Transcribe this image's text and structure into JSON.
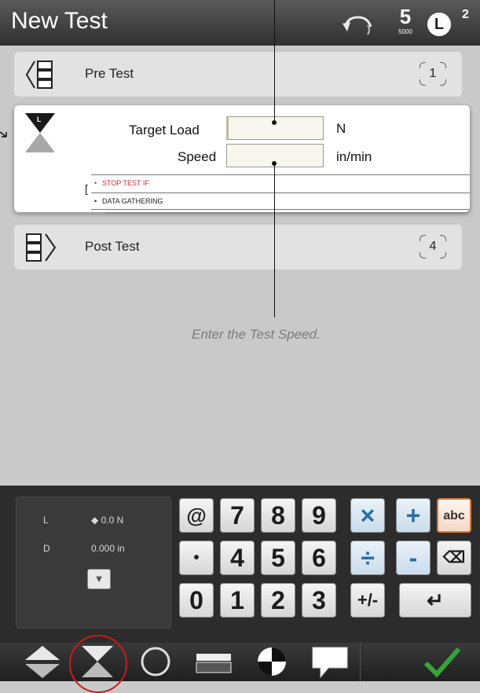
{
  "header": {
    "title": "New Test",
    "five_value": "5",
    "five_sub": "5000",
    "load_badge": "L",
    "load_badge_sup": "2"
  },
  "rows": {
    "pre_test": {
      "label": "Pre Test",
      "count": "1"
    },
    "post_test": {
      "label": "Post Test",
      "count": "4"
    }
  },
  "load_card": {
    "target_label": "Target Load",
    "speed_label": "Speed",
    "target_value": "",
    "speed_value": "",
    "target_unit": "N",
    "speed_unit": "in/min",
    "section_stop": "STOP TEST IF",
    "section_data": "DATA GATHERING",
    "left_char": "["
  },
  "callout": "Enter the Test Speed.",
  "status": {
    "l_label": "L",
    "l_value": "0.0 N",
    "d_label": "D",
    "d_value": "0.000 in"
  },
  "keypad": {
    "keys": {
      "at": "@",
      "seven": "7",
      "eight": "8",
      "nine": "9",
      "times": "×",
      "plus": "+",
      "abc": "abc",
      "dot": "•",
      "four": "4",
      "five": "5",
      "six": "6",
      "divide": "÷",
      "minus": "-",
      "zero": "0",
      "one": "1",
      "two": "2",
      "three": "3",
      "plusminus": "+/-"
    }
  },
  "colors": {
    "accent_green": "#35a33a",
    "selection_red": "#cc1a1a",
    "keypad_blue": "#2a6da8",
    "abc_orange": "#e07a3a"
  }
}
